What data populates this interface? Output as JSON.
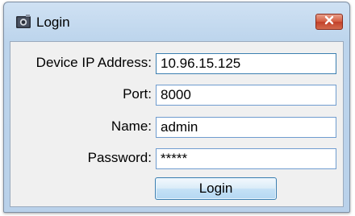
{
  "window": {
    "title": "Login",
    "icon": "camera-icon",
    "close_icon": "close-icon"
  },
  "form": {
    "ip_label": "Device IP Address:",
    "ip_value": "10.96.15.125",
    "port_label": "Port:",
    "port_value": "8000",
    "name_label": "Name:",
    "name_value": "admin",
    "password_label": "Password:",
    "password_value": "*****",
    "login_label": "Login"
  },
  "colors": {
    "close_button": "#c2402a",
    "field_border": "#6f9ccf",
    "title_bar": "#bcd4ec"
  }
}
